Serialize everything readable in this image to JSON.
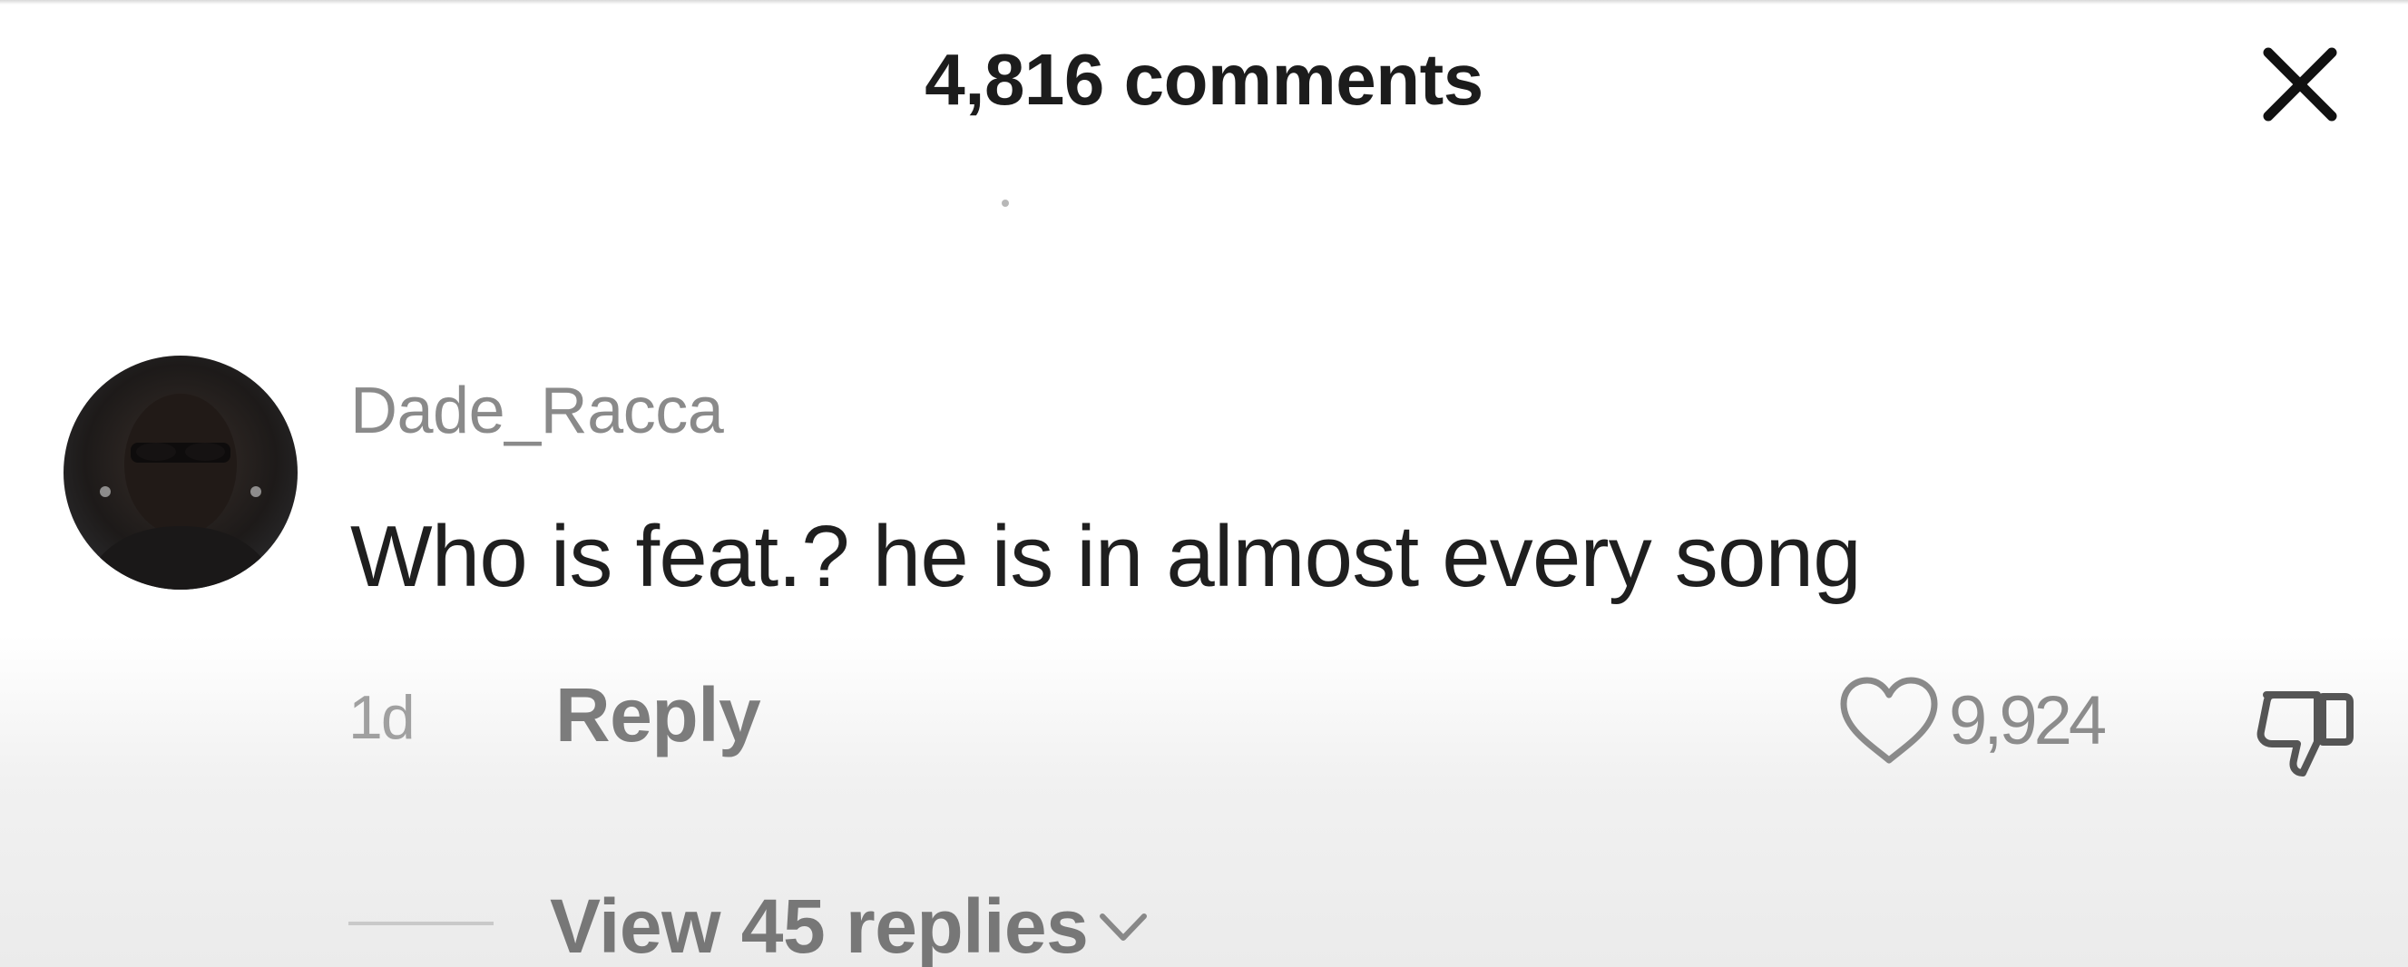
{
  "header": {
    "title": "4,816 comments",
    "close_icon": "close-icon"
  },
  "comment": {
    "avatar": "avatar",
    "username": "Dade_Racca",
    "text": "Who is feat.? he is in almost every song",
    "timestamp": "1d",
    "reply_label": "Reply",
    "like_icon": "heart-icon",
    "like_count": "9,924",
    "dislike_icon": "thumbs-down-icon",
    "view_replies_label": "View 45 replies",
    "view_replies_icon": "chevron-down-icon"
  },
  "colors": {
    "background": "#ffffff",
    "title_text": "#1c1c1c",
    "comment_text": "#1f1f1f",
    "muted_text": "#8a8a8a"
  }
}
